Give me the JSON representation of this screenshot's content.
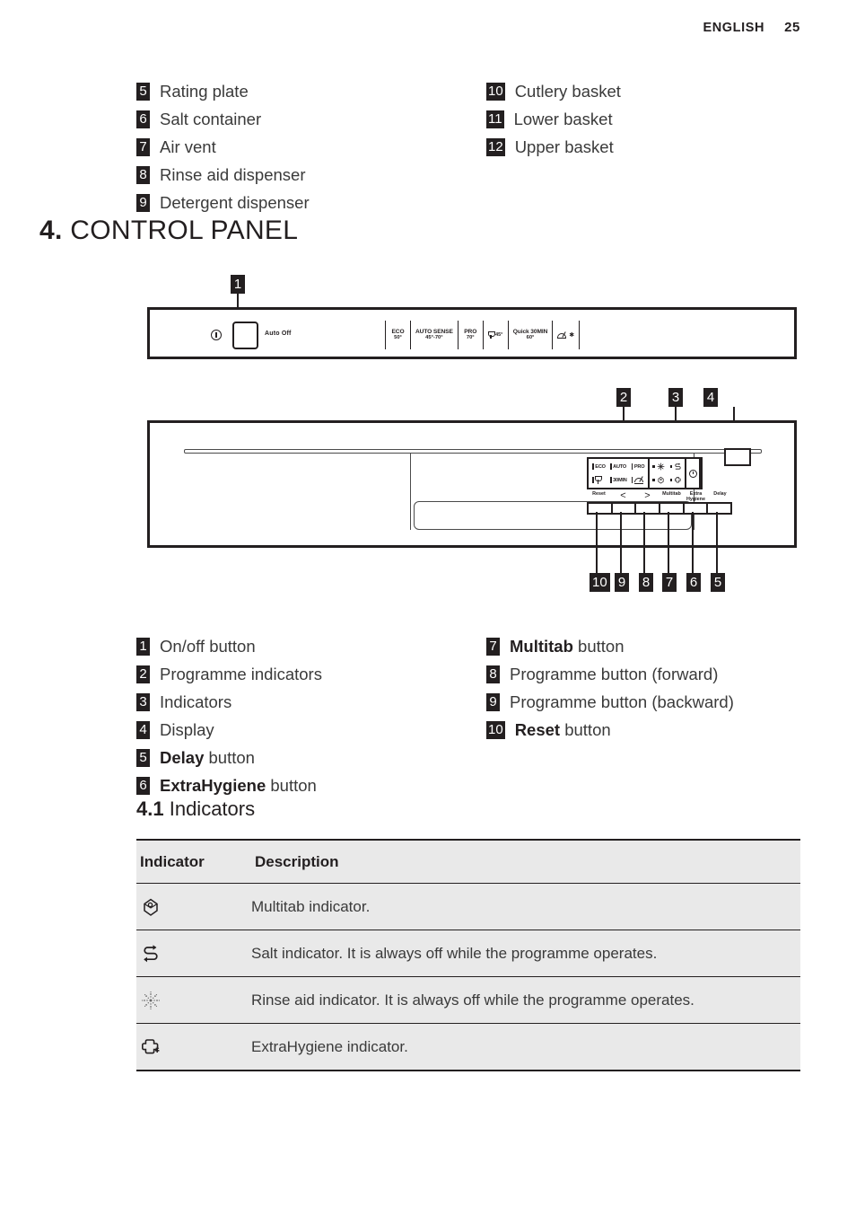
{
  "running_head": {
    "language": "ENGLISH",
    "page_number": "25"
  },
  "legend_top": {
    "left": [
      {
        "num": "5",
        "text": "Rating plate"
      },
      {
        "num": "6",
        "text": "Salt container"
      },
      {
        "num": "7",
        "text": "Air vent"
      },
      {
        "num": "8",
        "text": "Rinse aid dispenser"
      },
      {
        "num": "9",
        "text": "Detergent dispenser"
      }
    ],
    "right": [
      {
        "num": "10",
        "text": "Cutlery basket"
      },
      {
        "num": "11",
        "text": "Lower basket"
      },
      {
        "num": "12",
        "text": "Upper basket"
      }
    ]
  },
  "section": {
    "number": "4.",
    "title": "CONTROL PANEL"
  },
  "figure_top": {
    "callout": "1",
    "power_icon": "power-icon",
    "auto_off_label": "Auto Off",
    "programmes": [
      {
        "name": "ECO",
        "temp": "50°"
      },
      {
        "name": "AUTO SENSE",
        "temp": "45°-70°"
      },
      {
        "name": "PRO",
        "temp": "70°"
      },
      {
        "name": "glass-icon",
        "temp": "45°"
      },
      {
        "name": "Quick 30MIN",
        "temp": "60°"
      },
      {
        "name": "machine-care-icon",
        "temp": ""
      }
    ]
  },
  "figure_main": {
    "callouts_top": [
      "2",
      "3",
      "4"
    ],
    "callouts_bottom": [
      "10",
      "9",
      "8",
      "7",
      "6",
      "5"
    ],
    "programme_indicators": [
      {
        "label": "ECO"
      },
      {
        "label": "AUTO"
      },
      {
        "label": "PRO"
      },
      {
        "label": "glass-icon"
      },
      {
        "label": "30MIN"
      },
      {
        "label": "machine-care-icon"
      }
    ],
    "indicators": [
      "rinse-aid-icon",
      "salt-icon",
      "multitab-icon",
      "extrahygiene-icon"
    ],
    "clock_icon": "delay-clock-icon",
    "display": "display-screen",
    "buttons": [
      {
        "label": "Reset"
      },
      {
        "label": "<"
      },
      {
        "label": ">"
      },
      {
        "label": "Multitab"
      },
      {
        "label": "Extra Hygiene"
      },
      {
        "label": "Delay"
      }
    ]
  },
  "legend_bottom": {
    "left": [
      {
        "num": "1",
        "bold": "",
        "text": "On/off button"
      },
      {
        "num": "2",
        "bold": "",
        "text": "Programme indicators"
      },
      {
        "num": "3",
        "bold": "",
        "text": "Indicators"
      },
      {
        "num": "4",
        "bold": "",
        "text": "Display"
      },
      {
        "num": "5",
        "bold": "Delay",
        "text": " button"
      },
      {
        "num": "6",
        "bold": "ExtraHygiene",
        "text": " button"
      }
    ],
    "right": [
      {
        "num": "7",
        "bold": "Multitab",
        "text": " button"
      },
      {
        "num": "8",
        "bold": "",
        "text": "Programme button (forward)"
      },
      {
        "num": "9",
        "bold": "",
        "text": "Programme button (backward)"
      },
      {
        "num": "10",
        "bold": "Reset",
        "text": " button"
      }
    ]
  },
  "subsection": {
    "number": "4.1",
    "title": "Indicators"
  },
  "indicator_table": {
    "headers": [
      "Indicator",
      "Description"
    ],
    "rows": [
      {
        "icon": "multitab-icon",
        "description": "Multitab indicator."
      },
      {
        "icon": "salt-icon",
        "description": "Salt indicator. It is always off while the programme operates."
      },
      {
        "icon": "rinse-aid-icon",
        "description": "Rinse aid indicator. It is always off while the programme operates."
      },
      {
        "icon": "extrahygiene-icon",
        "description": "ExtraHygiene indicator."
      }
    ]
  },
  "colors": {
    "ink": "#231f20",
    "table_row_bg": "#e9e9e9",
    "body_text": "#3a3a3a"
  }
}
